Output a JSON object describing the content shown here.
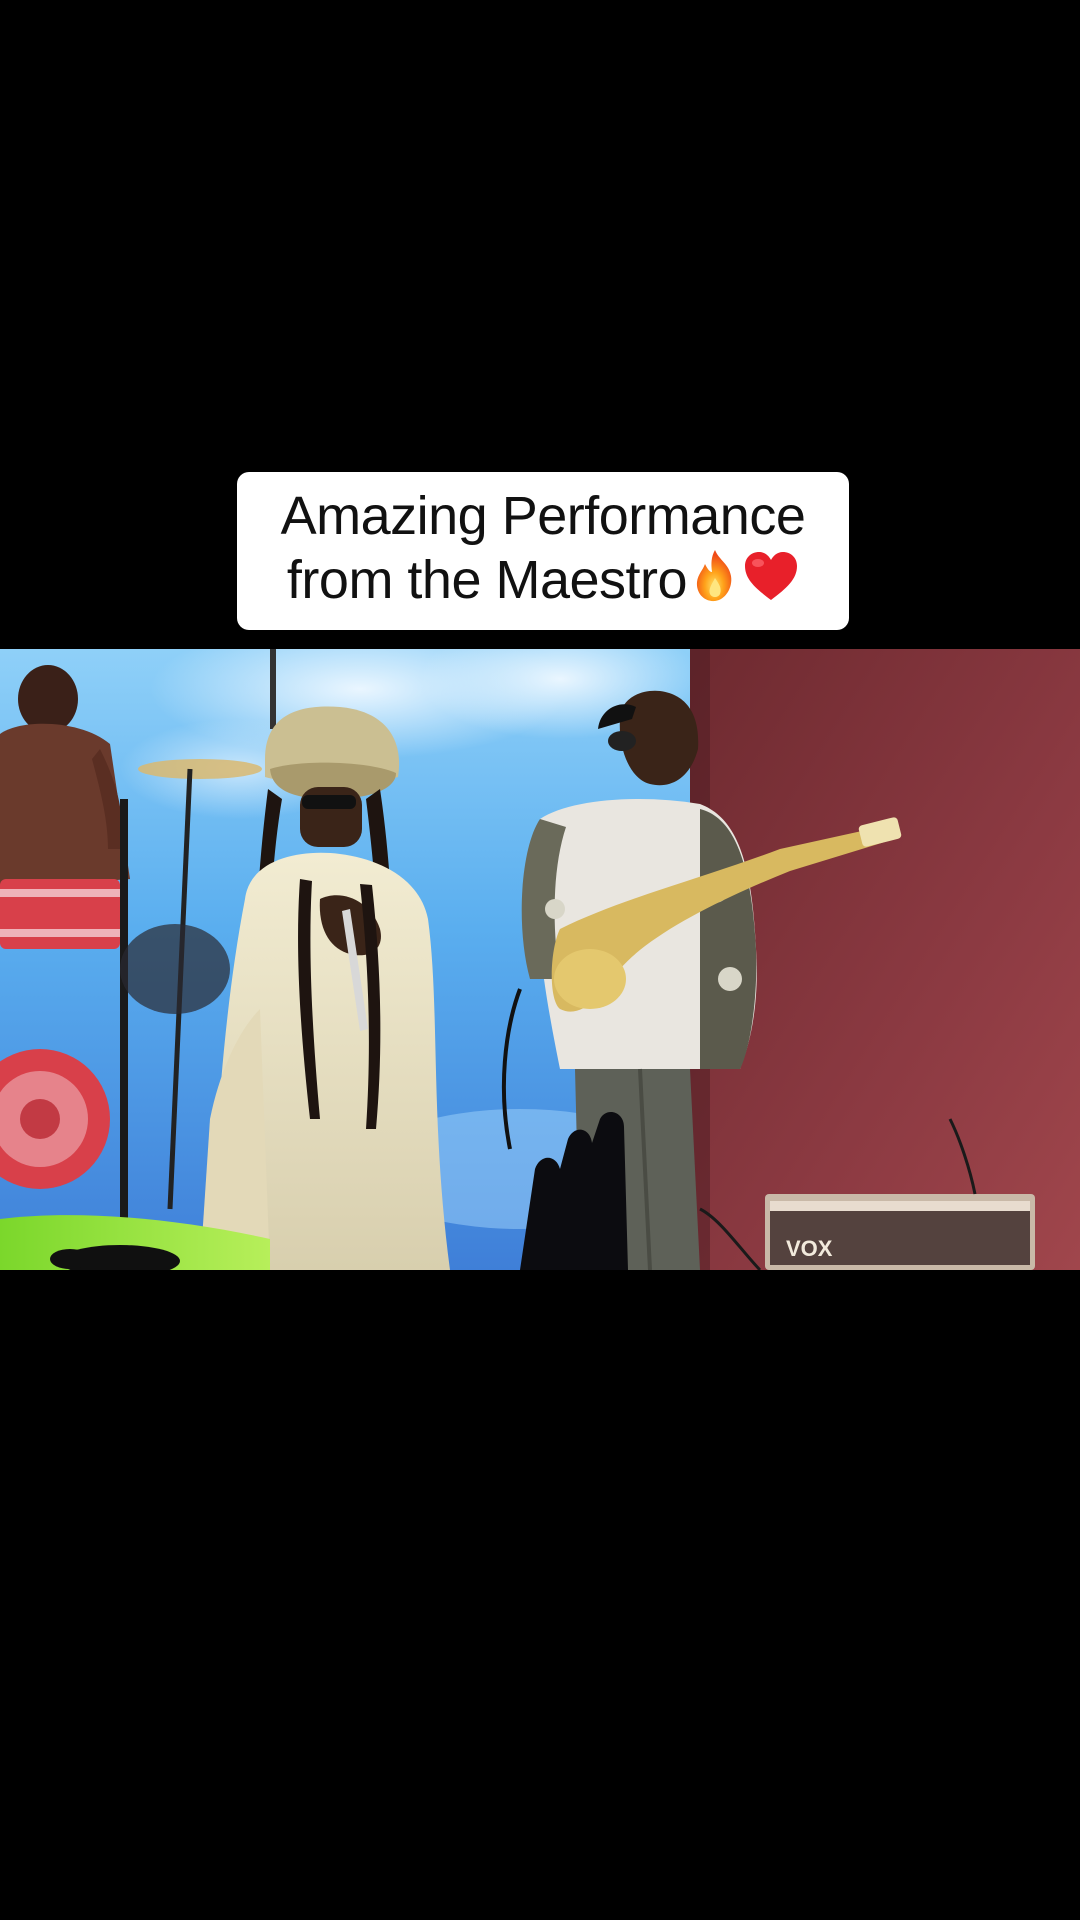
{
  "caption": {
    "line1": "Amazing Performance",
    "line2": "from the Maestro",
    "emojis": [
      "fire-emoji",
      "red-heart-emoji"
    ]
  },
  "video": {
    "amp_brand": "VOX"
  },
  "colors": {
    "background": "#000000",
    "caption_background": "#ffffff",
    "caption_text": "#111111",
    "stage_blue": "#5aa8ec",
    "stage_red": "#8a3438",
    "stage_green": "#7cdc2a"
  }
}
